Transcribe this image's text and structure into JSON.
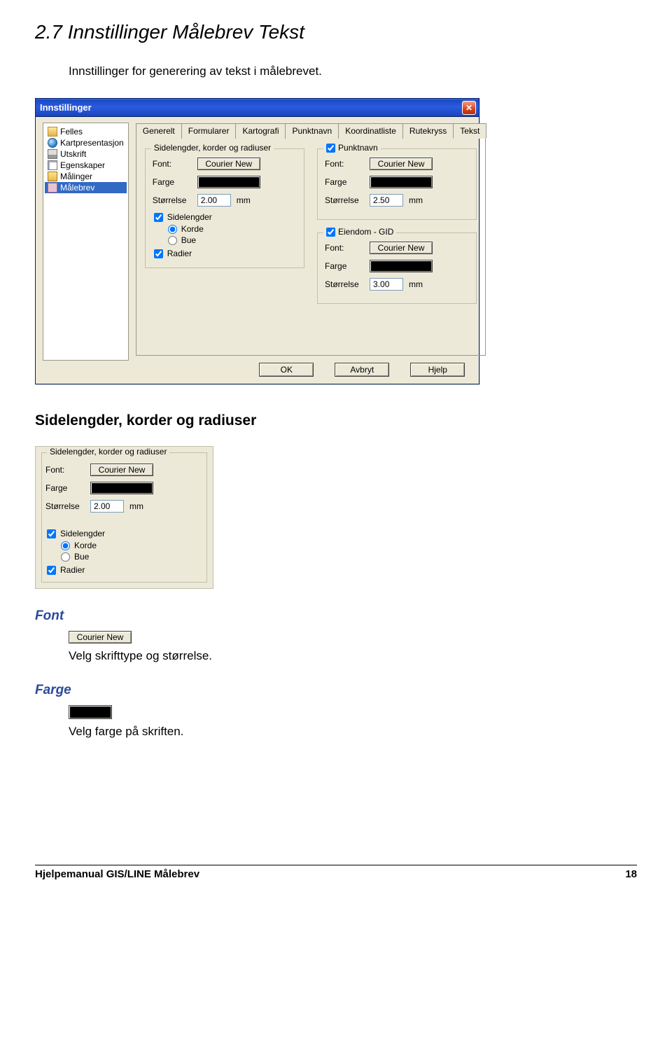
{
  "headings": {
    "h1": "2.7 Innstillinger Målebrev Tekst",
    "intro": "Innstillinger for generering av tekst i målebrevet.",
    "h2": "Sidelengder, korder og radiuser",
    "font": "Font",
    "farge": "Farge",
    "font_desc": "Velg  skrifttype og  størrelse.",
    "farge_desc": "Velg farge på skriften."
  },
  "dialog": {
    "title": "Innstillinger",
    "tree": [
      "Felles",
      "Kartpresentasjon",
      "Utskrift",
      "Egenskaper",
      "Målinger",
      "Målebrev"
    ],
    "tabs": [
      "Generelt",
      "Formularer",
      "Kartografi",
      "Punktnavn",
      "Koordinatliste",
      "Rutekryss",
      "Tekst"
    ],
    "active_tab": "Tekst",
    "group_sidelengder": {
      "title": "Sidelengder, korder og radiuser",
      "font_label": "Font:",
      "font_value": "Courier New",
      "farge_label": "Farge",
      "size_label": "Størrelse",
      "size_value": "2.00",
      "size_unit": "mm",
      "chk_sidelengder": "Sidelengder",
      "radio_korde": "Korde",
      "radio_bue": "Bue",
      "chk_radier": "Radier"
    },
    "group_punktnavn": {
      "title": "Punktnavn",
      "font_label": "Font:",
      "font_value": "Courier New",
      "farge_label": "Farge",
      "size_label": "Størrelse",
      "size_value": "2.50",
      "size_unit": "mm"
    },
    "group_eiendom": {
      "title": "Eiendom  -  GID",
      "font_label": "Font:",
      "font_value": "Courier New",
      "farge_label": "Farge",
      "size_label": "Størrelse",
      "size_value": "3.00",
      "size_unit": "mm"
    },
    "buttons": {
      "ok": "OK",
      "cancel": "Avbryt",
      "help": "Hjelp"
    }
  },
  "panel2": {
    "title": "Sidelengder, korder og radiuser",
    "font_label": "Font:",
    "font_value": "Courier New",
    "farge_label": "Farge",
    "size_label": "Størrelse",
    "size_value": "2.00",
    "size_unit": "mm",
    "chk_sidelengder": "Sidelengder",
    "radio_korde": "Korde",
    "radio_bue": "Bue",
    "chk_radier": "Radier"
  },
  "fontbtn_example": "Courier New",
  "footer": {
    "left": "Hjelpemanual GIS/LINE Målebrev",
    "page": "18"
  }
}
